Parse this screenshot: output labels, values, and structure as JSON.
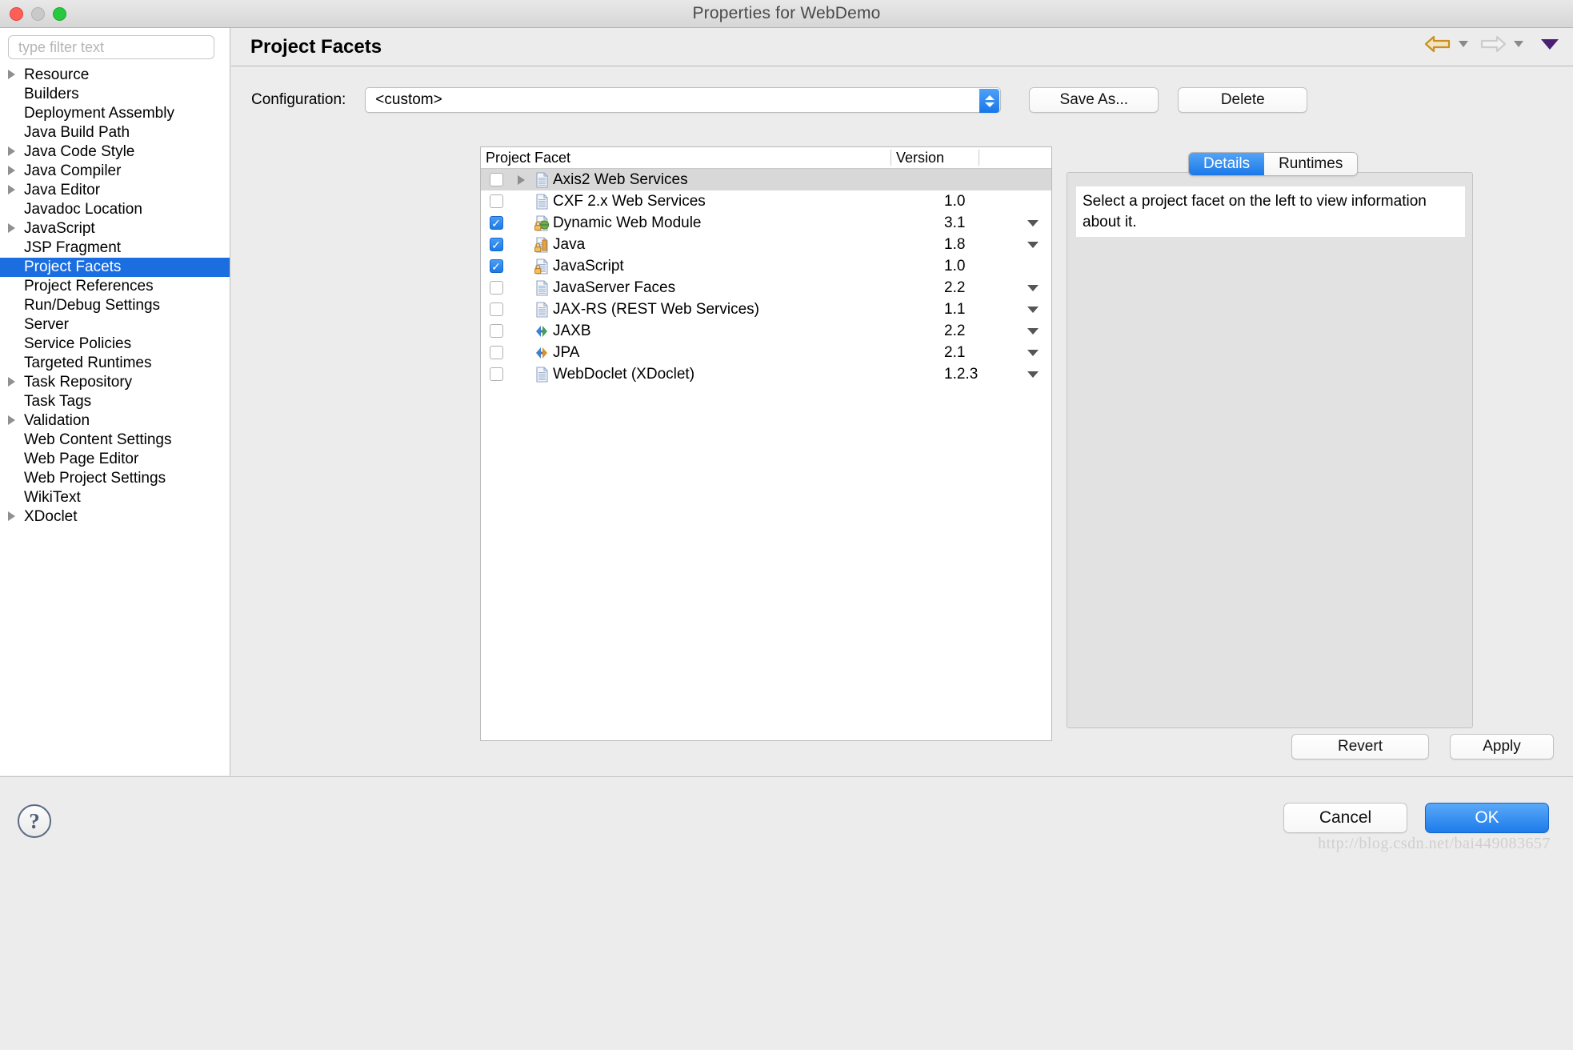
{
  "window": {
    "title": "Properties for WebDemo",
    "traffic_lights": [
      "close",
      "minimize",
      "zoom"
    ]
  },
  "sidebar": {
    "filter": {
      "placeholder": "type filter text",
      "value": ""
    },
    "items": [
      {
        "label": "Resource",
        "expandable": true,
        "selected": false
      },
      {
        "label": "Builders",
        "expandable": false,
        "selected": false
      },
      {
        "label": "Deployment Assembly",
        "expandable": false,
        "selected": false
      },
      {
        "label": "Java Build Path",
        "expandable": false,
        "selected": false
      },
      {
        "label": "Java Code Style",
        "expandable": true,
        "selected": false
      },
      {
        "label": "Java Compiler",
        "expandable": true,
        "selected": false
      },
      {
        "label": "Java Editor",
        "expandable": true,
        "selected": false
      },
      {
        "label": "Javadoc Location",
        "expandable": false,
        "selected": false
      },
      {
        "label": "JavaScript",
        "expandable": true,
        "selected": false
      },
      {
        "label": "JSP Fragment",
        "expandable": false,
        "selected": false
      },
      {
        "label": "Project Facets",
        "expandable": false,
        "selected": true
      },
      {
        "label": "Project References",
        "expandable": false,
        "selected": false
      },
      {
        "label": "Run/Debug Settings",
        "expandable": false,
        "selected": false
      },
      {
        "label": "Server",
        "expandable": false,
        "selected": false
      },
      {
        "label": "Service Policies",
        "expandable": false,
        "selected": false
      },
      {
        "label": "Targeted Runtimes",
        "expandable": false,
        "selected": false
      },
      {
        "label": "Task Repository",
        "expandable": true,
        "selected": false
      },
      {
        "label": "Task Tags",
        "expandable": false,
        "selected": false
      },
      {
        "label": "Validation",
        "expandable": true,
        "selected": false
      },
      {
        "label": "Web Content Settings",
        "expandable": false,
        "selected": false
      },
      {
        "label": "Web Page Editor",
        "expandable": false,
        "selected": false
      },
      {
        "label": "Web Project Settings",
        "expandable": false,
        "selected": false
      },
      {
        "label": "WikiText",
        "expandable": false,
        "selected": false
      },
      {
        "label": "XDoclet",
        "expandable": true,
        "selected": false
      }
    ]
  },
  "page": {
    "title": "Project Facets",
    "nav": {
      "back_icon": "back-arrow-icon",
      "forward_icon": "forward-arrow-icon",
      "menu_icon": "dropdown-triangle-icon"
    }
  },
  "configuration": {
    "label": "Configuration:",
    "value": "<custom>",
    "save_as_label": "Save As...",
    "delete_label": "Delete"
  },
  "facets_table": {
    "headers": {
      "facet": "Project Facet",
      "version": "Version",
      "blank": ""
    },
    "rows": [
      {
        "name": "Axis2 Web Services",
        "version": "",
        "checked": false,
        "expandable": true,
        "has_dropdown": false,
        "highlight": true,
        "icon": "document-icon"
      },
      {
        "name": "CXF 2.x Web Services",
        "version": "1.0",
        "checked": false,
        "expandable": false,
        "has_dropdown": false,
        "highlight": false,
        "icon": "document-icon"
      },
      {
        "name": "Dynamic Web Module",
        "version": "3.1",
        "checked": true,
        "expandable": false,
        "has_dropdown": true,
        "highlight": false,
        "icon": "web-module-lock-icon"
      },
      {
        "name": "Java",
        "version": "1.8",
        "checked": true,
        "expandable": false,
        "has_dropdown": true,
        "highlight": false,
        "icon": "java-lock-icon"
      },
      {
        "name": "JavaScript",
        "version": "1.0",
        "checked": true,
        "expandable": false,
        "has_dropdown": false,
        "highlight": false,
        "icon": "javascript-lock-icon"
      },
      {
        "name": "JavaServer Faces",
        "version": "2.2",
        "checked": false,
        "expandable": false,
        "has_dropdown": true,
        "highlight": false,
        "icon": "document-icon"
      },
      {
        "name": "JAX-RS (REST Web Services)",
        "version": "1.1",
        "checked": false,
        "expandable": false,
        "has_dropdown": true,
        "highlight": false,
        "icon": "document-icon"
      },
      {
        "name": "JAXB",
        "version": "2.2",
        "checked": false,
        "expandable": false,
        "has_dropdown": true,
        "highlight": false,
        "icon": "jaxb-arrows-icon"
      },
      {
        "name": "JPA",
        "version": "2.1",
        "checked": false,
        "expandable": false,
        "has_dropdown": true,
        "highlight": false,
        "icon": "jpa-arrows-icon"
      },
      {
        "name": "WebDoclet (XDoclet)",
        "version": "1.2.3",
        "checked": false,
        "expandable": false,
        "has_dropdown": true,
        "highlight": false,
        "icon": "document-icon"
      }
    ]
  },
  "details": {
    "tabs": [
      {
        "label": "Details",
        "active": true
      },
      {
        "label": "Runtimes",
        "active": false
      }
    ],
    "message": "Select a project facet on the left to view information about it."
  },
  "actions": {
    "revert_label": "Revert",
    "apply_label": "Apply",
    "cancel_label": "Cancel",
    "ok_label": "OK",
    "help_glyph": "?"
  },
  "watermark": "http://blog.csdn.net/bai449083657",
  "colors": {
    "accent_blue": "#1a6ee0",
    "ok_blue": "#1d7bea",
    "back_arrow_gold": "#c8901e",
    "menu_purple": "#4b1f73",
    "row_highlight": "#d8d8d8"
  }
}
